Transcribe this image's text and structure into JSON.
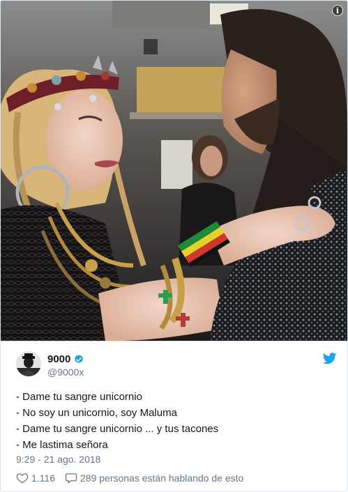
{
  "tweet": {
    "display_name": "9000",
    "handle": "@9000x",
    "lines": [
      "- Dame tu sangre unicornio",
      "- No soy un unicornio, soy Maluma",
      "- Dame tu sangre unicornio ... y tus tacones",
      "- Me lastima señora"
    ],
    "timestamp": "9:29 - 21 ago. 2018",
    "likes_count": "1.116",
    "replies_text": "289 personas están hablando de esto"
  },
  "icons": {
    "info": "info-icon",
    "verified": "verified-badge-icon",
    "brand": "twitter-bird-icon",
    "like": "heart-icon",
    "reply": "speech-bubble-icon"
  },
  "colors": {
    "brand_blue": "#1da1f2",
    "secondary_text": "#657786",
    "primary_text": "#14171a",
    "border": "#e1e8ed"
  }
}
